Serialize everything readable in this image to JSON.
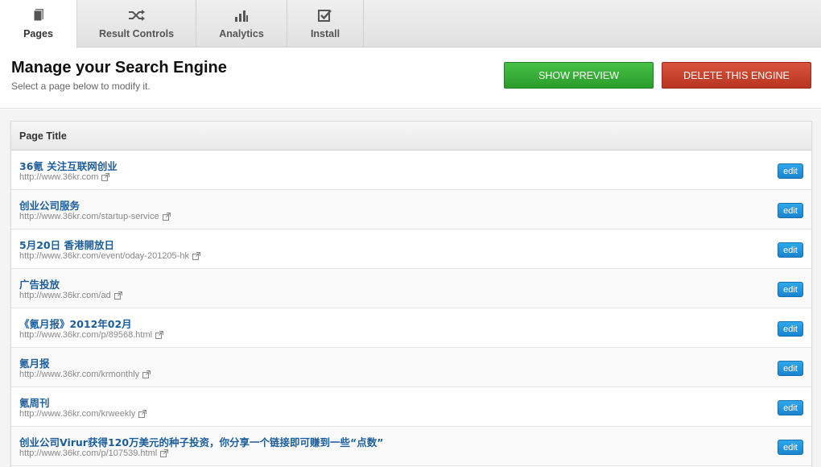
{
  "tabs": [
    {
      "label": "Pages",
      "icon": "document-icon",
      "active": true
    },
    {
      "label": "Result Controls",
      "icon": "shuffle-icon",
      "active": false
    },
    {
      "label": "Analytics",
      "icon": "bar-chart-icon",
      "active": false
    },
    {
      "label": "Install",
      "icon": "checkbox-icon",
      "active": false
    }
  ],
  "header": {
    "title": "Manage your Search Engine",
    "subtitle": "Select a page below to modify it.",
    "preview_label": "SHOW PREVIEW",
    "delete_label": "DELETE THIS ENGINE"
  },
  "table": {
    "column_header": "Page Title",
    "edit_label": "edit",
    "rows": [
      {
        "title": "36氪 关注互联网创业",
        "url": "http://www.36kr.com"
      },
      {
        "title": "创业公司服务",
        "url": "http://www.36kr.com/startup-service"
      },
      {
        "title": "5月20日 香港開放日",
        "url": "http://www.36kr.com/event/oday-201205-hk"
      },
      {
        "title": "广告投放",
        "url": "http://www.36kr.com/ad"
      },
      {
        "title": "《氪月报》2012年02月",
        "url": "http://www.36kr.com/p/89568.html"
      },
      {
        "title": "氪月报",
        "url": "http://www.36kr.com/krmonthly"
      },
      {
        "title": "氪周刊",
        "url": "http://www.36kr.com/krweekly"
      },
      {
        "title": "创业公司Virur获得120万美元的种子投资，你分享一个链接即可赚到一些“点数”",
        "url": "http://www.36kr.com/p/107539.html"
      }
    ]
  },
  "colors": {
    "preview": "#2b9c2b",
    "delete": "#b93521",
    "link": "#1c5d9c",
    "edit": "#1a84cf"
  }
}
